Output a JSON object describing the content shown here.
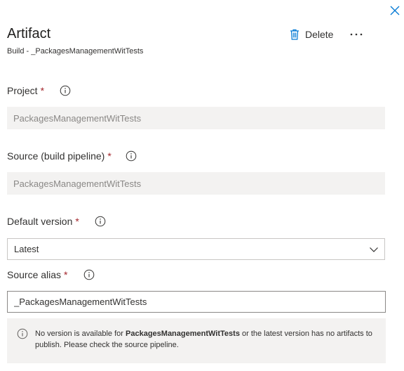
{
  "panel": {
    "title": "Artifact",
    "subtitle": "Build - _PackagesManagementWitTests",
    "delete_label": "Delete"
  },
  "form": {
    "project": {
      "label": "Project",
      "required_mark": "*",
      "value": "PackagesManagementWitTests"
    },
    "source": {
      "label": "Source (build pipeline)",
      "required_mark": "*",
      "value": "PackagesManagementWitTests"
    },
    "default_version": {
      "label": "Default version",
      "required_mark": "*",
      "selected": "Latest"
    },
    "source_alias": {
      "label": "Source alias",
      "required_mark": "*",
      "value": "_PackagesManagementWitTests"
    }
  },
  "notice": {
    "prefix": "No version is available for ",
    "bold": "PackagesManagementWitTests",
    "suffix": " or the latest version has no artifacts to publish. Please check the source pipeline."
  },
  "colors": {
    "accent": "#0078d4",
    "required": "#a4262c",
    "readonly_bg": "#f3f2f1"
  },
  "icons": [
    "close-icon",
    "trash-icon",
    "more-icon",
    "info-icon",
    "chevron-down-icon"
  ]
}
